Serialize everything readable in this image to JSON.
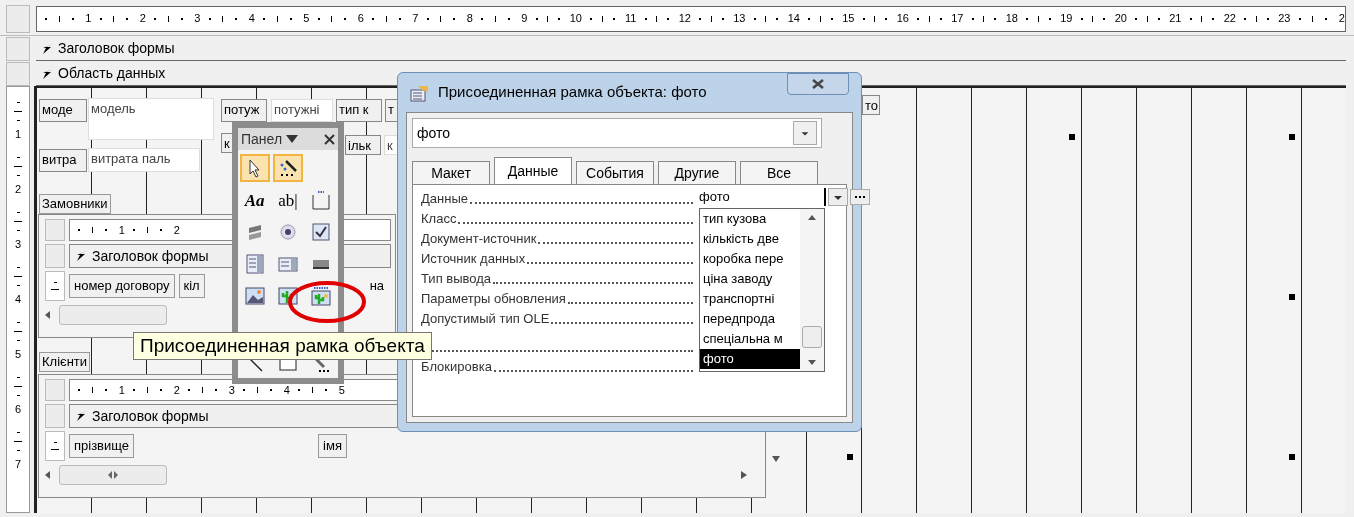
{
  "ruler": {
    "marks": [
      "1",
      "2",
      "3",
      "4",
      "5",
      "6",
      "7",
      "8",
      "9",
      "10",
      "11",
      "12",
      "13",
      "14",
      "15",
      "16",
      "17",
      "18",
      "19",
      "20",
      "21",
      "22",
      "23",
      "2"
    ]
  },
  "vertical_ruler": {
    "marks": [
      "1",
      "2",
      "3",
      "4",
      "5",
      "6",
      "7"
    ]
  },
  "sections": [
    {
      "title": "Заголовок формы"
    },
    {
      "title": "Область данных"
    }
  ],
  "controls": [
    {
      "kind": "label",
      "text": "моде"
    },
    {
      "kind": "textbox",
      "text": "модель"
    },
    {
      "kind": "label",
      "text": "потуж"
    },
    {
      "kind": "textbox",
      "text": "потужні"
    },
    {
      "kind": "label",
      "text": "тип к"
    },
    {
      "kind": "label",
      "text": "т"
    },
    {
      "kind": "label",
      "text": "к"
    },
    {
      "kind": "label",
      "text": "ільк"
    },
    {
      "kind": "textbox",
      "text": "к"
    },
    {
      "kind": "label",
      "text": "витра"
    },
    {
      "kind": "textbox",
      "text": "витрата паль"
    },
    {
      "kind": "label",
      "text": "то"
    }
  ],
  "subforms": [
    {
      "caption": "Замовники",
      "ruler": [
        "1",
        "2"
      ],
      "header": "Заголовок формы",
      "fields": [
        "номер договору",
        "кіл",
        "на"
      ]
    },
    {
      "caption": "Клієнти",
      "ruler": [
        "1",
        "2",
        "3",
        "4",
        "5"
      ],
      "header": "Заголовок формы",
      "fields": [
        "прізвище",
        "імя"
      ]
    }
  ],
  "toolbox": {
    "title": "Панел",
    "tools": [
      {
        "kind": "pointer",
        "selected": true
      },
      {
        "kind": "wizard",
        "selected": true
      },
      {
        "kind": "label",
        "glyph": "Aa",
        "selected": false
      },
      {
        "kind": "textbox",
        "glyph": "ab|",
        "selected": false
      },
      {
        "kind": "group",
        "selected": false
      },
      {
        "kind": "toggle",
        "selected": false
      },
      {
        "kind": "radio",
        "selected": false
      },
      {
        "kind": "checkbox",
        "selected": false
      },
      {
        "kind": "combobox",
        "selected": false
      },
      {
        "kind": "listbox",
        "selected": false
      },
      {
        "kind": "command",
        "selected": false
      },
      {
        "kind": "image",
        "selected": false
      },
      {
        "kind": "unbound-frame",
        "selected": false
      },
      {
        "kind": "bound-frame",
        "selected": false
      },
      {
        "kind": "line",
        "selected": false
      },
      {
        "kind": "rectangle",
        "selected": false
      },
      {
        "kind": "more",
        "selected": false
      }
    ]
  },
  "highlight": {
    "kind": "ellipse"
  },
  "tooltip": "Присоединенная рамка объекта",
  "dialog": {
    "title": "Присоединенная рамка объекта: фото",
    "object": "фото",
    "tabs": [
      {
        "label": "Макет",
        "selected": false
      },
      {
        "label": "Данные",
        "selected": true
      },
      {
        "label": "События",
        "selected": false
      },
      {
        "label": "Другие",
        "selected": false
      },
      {
        "label": "Все",
        "selected": false
      }
    ],
    "properties": [
      {
        "label": "Данные",
        "value": "фото",
        "covered": false
      },
      {
        "label": "Класс",
        "covered": false
      },
      {
        "label": "Документ-источник",
        "covered": false
      },
      {
        "label": "Источник данных",
        "covered": false
      },
      {
        "label": "Тип вывода",
        "covered": false
      },
      {
        "label": "Параметры обновления",
        "covered": false
      },
      {
        "label": "Допустимый тип OLE",
        "covered": false
      },
      {
        "covered": true
      },
      {
        "label": "Блокировка",
        "covered": false
      }
    ],
    "dropdown": [
      {
        "text": "тип кузова",
        "selected": false
      },
      {
        "text": "кількість две",
        "selected": false
      },
      {
        "text": "коробка пере",
        "selected": false
      },
      {
        "text": "ціна заводу",
        "selected": false
      },
      {
        "text": "транспортні",
        "selected": false
      },
      {
        "text": "передпрода",
        "selected": false
      },
      {
        "text": "спеціальна м",
        "selected": false
      },
      {
        "text": "фото",
        "selected": true
      }
    ]
  }
}
